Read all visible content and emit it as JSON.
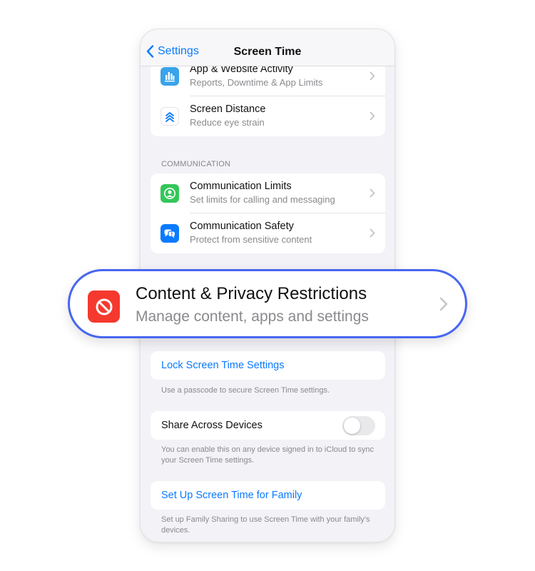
{
  "nav": {
    "back_label": "Settings",
    "title": "Screen Time"
  },
  "groups": {
    "top": [
      {
        "title": "App & Website Activity",
        "subtitle": "Reports, Downtime & App Limits",
        "icon": "bar-chart-icon",
        "icon_color": "#3aa3ea"
      },
      {
        "title": "Screen Distance",
        "subtitle": "Reduce eye strain",
        "icon": "chevrons-up-icon",
        "icon_color": "#ffffff"
      }
    ],
    "communication_header": "COMMUNICATION",
    "communication": [
      {
        "title": "Communication Limits",
        "subtitle": "Set limits for calling and messaging",
        "icon": "person-circle-icon",
        "icon_color": "#34c759"
      },
      {
        "title": "Communication Safety",
        "subtitle": "Protect from sensitive content",
        "icon": "chat-bubbles-alert-icon",
        "icon_color": "#0a7aff"
      }
    ]
  },
  "callout": {
    "title": "Content & Privacy Restrictions",
    "subtitle": "Manage content, apps and settings",
    "icon": "prohibited-icon",
    "icon_color": "#f5392f",
    "border_color": "#4866f0"
  },
  "lock": {
    "label": "Lock Screen Time Settings",
    "footer": "Use a passcode to secure Screen Time settings."
  },
  "share": {
    "label": "Share Across Devices",
    "enabled": false,
    "footer": "You can enable this on any device signed in to iCloud to sync your Screen Time settings."
  },
  "family": {
    "label": "Set Up Screen Time for Family",
    "footer": "Set up Family Sharing to use Screen Time with your family's devices."
  },
  "colors": {
    "accent": "#0a7aff",
    "background": "#f2f2f7"
  }
}
